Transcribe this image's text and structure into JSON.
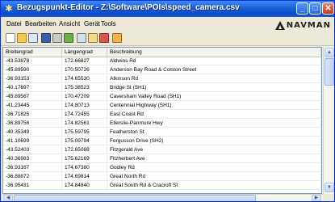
{
  "window": {
    "title": "Bezugspunkt-Editor - Z:\\Software\\POIs\\speed_camera.csv",
    "minimize_glyph": "_",
    "maximize_glyph": "□",
    "close_glyph": "✕"
  },
  "menu": {
    "items": [
      "Datei",
      "Bearbeiten",
      "Ansicht",
      "Gerät",
      "Tools"
    ]
  },
  "brand": {
    "name": "NAVMAN"
  },
  "toolbar": {
    "icons": [
      "new-file-icon",
      "open-folder-icon",
      "copy-icon",
      "save-icon",
      "print-icon",
      "import-icon",
      "list-icon",
      "find-icon",
      "edit-icon",
      "export-icon"
    ]
  },
  "colors": {
    "titlebar": "#0a4bc7",
    "window_bg": "#ece9d8",
    "grid_border": "#7f9db9"
  },
  "grid": {
    "headers": [
      "Breitengrad",
      "Längengrad",
      "Beschreibung"
    ],
    "rows": [
      [
        "-43.53878",
        "172.66827",
        "Aldwins Rd"
      ],
      [
        "-45.89590",
        "170.50726",
        "Anderson Bay Road & Colston Street"
      ],
      [
        "-36.93153",
        "174.65530",
        "Atkinson Rd"
      ],
      [
        "-40.17697",
        "175.38523",
        "Bridge St (SH1)"
      ],
      [
        "-45.89567",
        "170.47209",
        "Caversham Valley Road (SH1)"
      ],
      [
        "-41.23445",
        "174.80713",
        "Centennial Highway (SH1)"
      ],
      [
        "-36.71825",
        "174.72455",
        "East Coast Rd"
      ],
      [
        "-36.89756",
        "174.82561",
        "Ellerslie-Panmure Hwy"
      ],
      [
        "-40.35349",
        "175.59795",
        "Featherston St"
      ],
      [
        "-41.10699",
        "175.09794",
        "Fergusson Drive (SH2)"
      ],
      [
        "-43.52403",
        "172.65088",
        "Fitzgerald Ave"
      ],
      [
        "-40.36983",
        "175.62169",
        "Fitzherbert Ave"
      ],
      [
        "-36.93167",
        "174.67380",
        "Godley Rd"
      ],
      [
        "-36.88872",
        "174.69814",
        "Great North Rd"
      ],
      [
        "-36.95431",
        "174.84840",
        "Great South Rd & Cracroft St"
      ]
    ]
  }
}
